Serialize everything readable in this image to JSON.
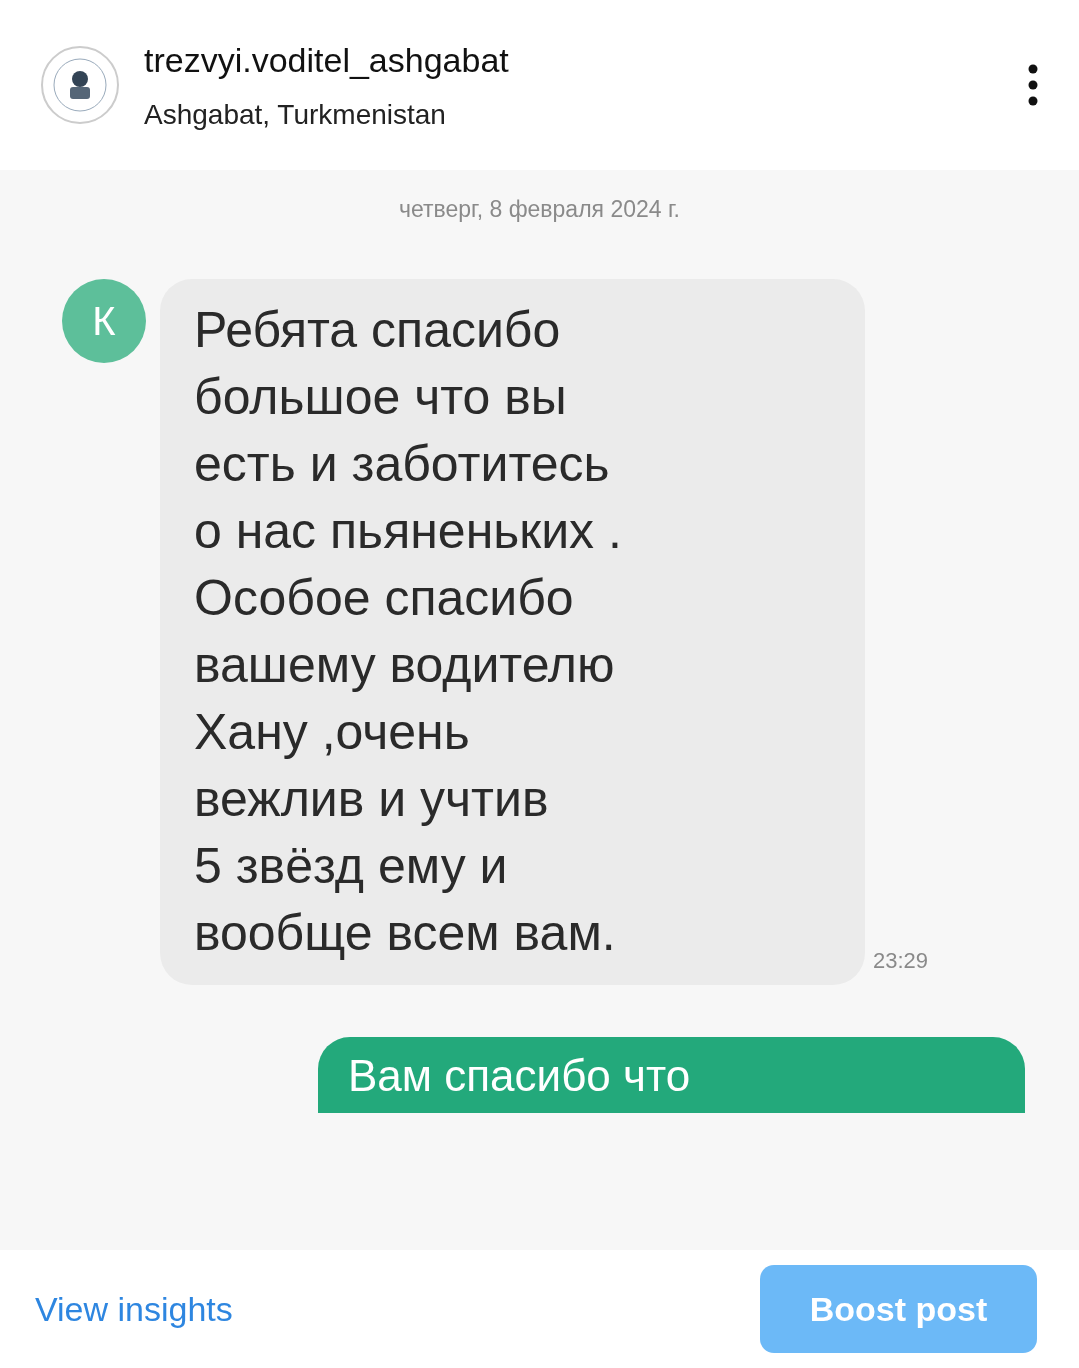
{
  "header": {
    "username": "trezvyi.voditel_ashgabat",
    "location": "Ashgabat, Turkmenistan"
  },
  "post": {
    "date": "четверг, 8 февраля 2024 г.",
    "messages": [
      {
        "kind": "incoming",
        "avatar": "К",
        "text": "Ребята спасибо\nбольшое что вы\nесть и заботитесь\nо нас пьяненьких .\nОсобое спасибо\nвашему водителю\nХану ,очень\nвежлив и учтив\n5 звёзд ему и\nвообще всем вам.",
        "time": "23:29"
      },
      {
        "kind": "outgoing",
        "text": "Вам спасибо что"
      }
    ]
  },
  "footer": {
    "insights": "View insights",
    "boost": "Boost post"
  }
}
